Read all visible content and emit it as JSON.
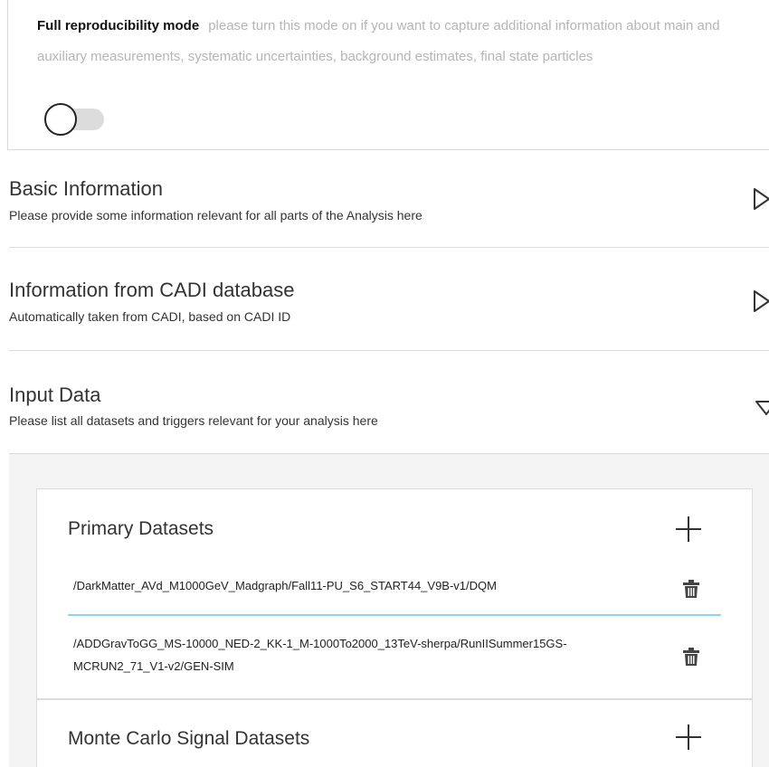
{
  "repro_mode": {
    "title": "Full reproducibility mode",
    "description": "please turn this mode on if you want to capture additional information about main and auxiliary measurements, systematic uncertainties, background estimates, final state particles",
    "toggle_on": false
  },
  "sections": [
    {
      "title": "Basic Information",
      "subtitle": "Please provide some information relevant for all parts of the Analysis here",
      "expanded": false
    },
    {
      "title": "Information from CADI database",
      "subtitle": "Automatically taken from CADI, based on CADI ID",
      "expanded": false
    },
    {
      "title": "Input Data",
      "subtitle": "Please list all datasets and triggers relevant for your analysis here",
      "expanded": true
    }
  ],
  "input_data": {
    "primary_datasets": {
      "title": "Primary Datasets",
      "items": [
        "/DarkMatter_AVd_M1000GeV_Madgraph/Fall11-PU_S6_START44_V9B-v1/DQM",
        "/ADDGravToGG_MS-10000_NED-2_KK-1_M-1000To2000_13TeV-sherpa/RunIISummer15GS-MCRUN2_71_V1-v2/GEN-SIM"
      ]
    },
    "mc_signal_datasets": {
      "title": "Monte Carlo Signal Datasets"
    }
  },
  "icons": {
    "expand": "triangle-right-icon",
    "collapse": "triangle-down-icon",
    "add": "plus-icon",
    "delete": "trash-icon"
  }
}
